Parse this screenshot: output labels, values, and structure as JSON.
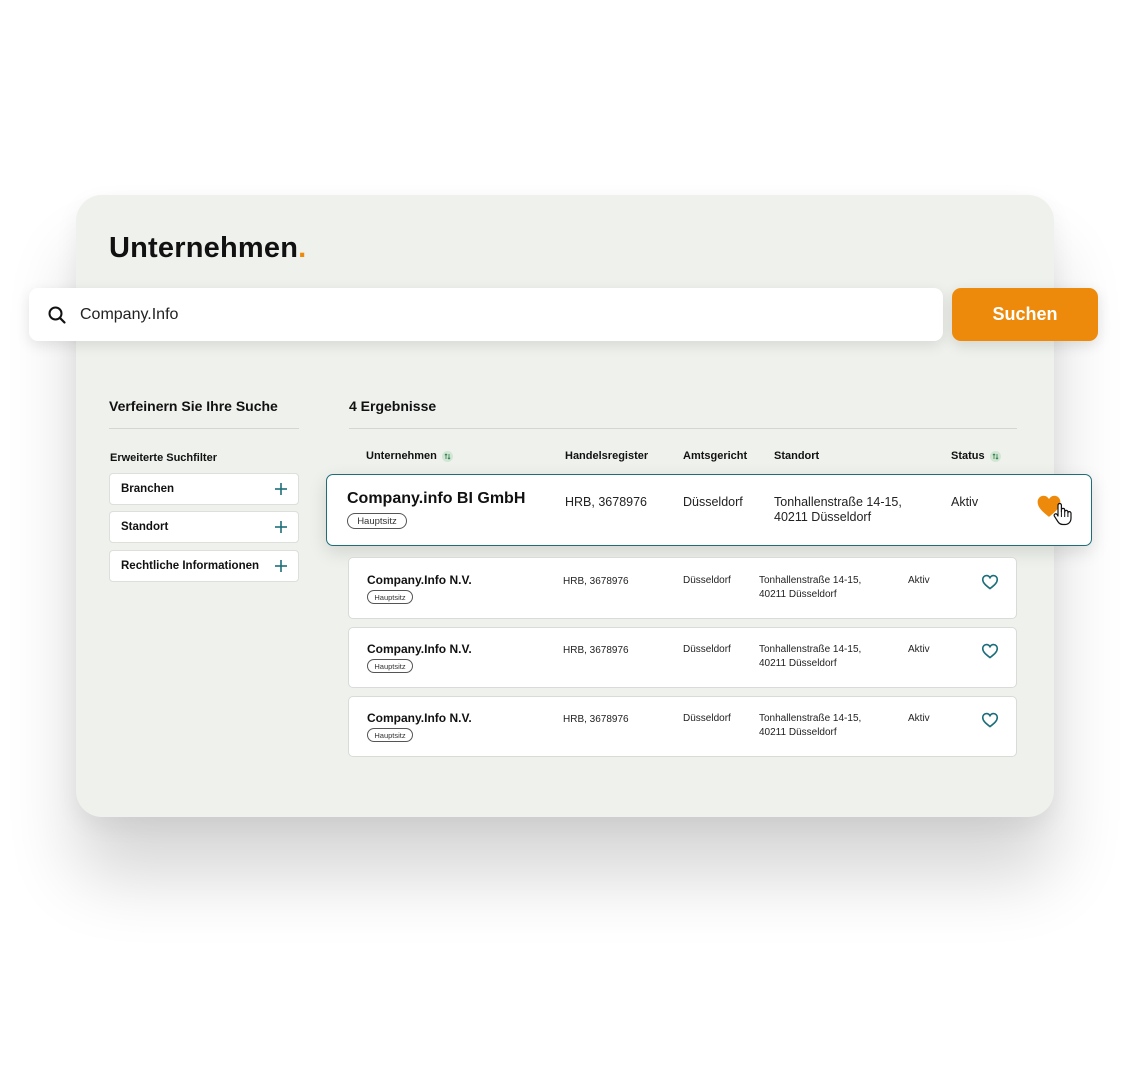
{
  "header": {
    "title": "Unternehmen",
    "title_dot": "."
  },
  "search": {
    "value": "Company.Info",
    "placeholder": "",
    "button_label": "Suchen"
  },
  "filters": {
    "heading": "Verfeinern Sie Ihre Suche",
    "subheading": "Erweiterte Suchfilter",
    "items": [
      {
        "label": "Branchen"
      },
      {
        "label": "Standort"
      },
      {
        "label": "Rechtliche Informationen"
      }
    ]
  },
  "results": {
    "count_label": "4 Ergebnisse",
    "columns": {
      "company": "Unternehmen",
      "register": "Handelsregister",
      "court": "Amtsgericht",
      "location": "Standort",
      "status": "Status"
    },
    "rows": [
      {
        "name": "Company.info BI GmbH",
        "tag": "Hauptsitz",
        "register": "HRB, 3678976",
        "court": "Düsseldorf",
        "address_line1": "Tonhallenstraße 14-15,",
        "address_line2": "40211 Düsseldorf",
        "status": "Aktiv",
        "favorite": true
      },
      {
        "name": "Company.Info  N.V.",
        "tag": "Hauptsitz",
        "register": "HRB, 3678976",
        "court": "Düsseldorf",
        "address_line1": "Tonhallenstraße 14-15,",
        "address_line2": "40211 Düsseldorf",
        "status": "Aktiv",
        "favorite": false
      },
      {
        "name": "Company.Info  N.V.",
        "tag": "Hauptsitz",
        "register": "HRB, 3678976",
        "court": "Düsseldorf",
        "address_line1": "Tonhallenstraße 14-15,",
        "address_line2": "40211 Düsseldorf",
        "status": "Aktiv",
        "favorite": false
      },
      {
        "name": "Company.Info  N.V.",
        "tag": "Hauptsitz",
        "register": "HRB, 3678976",
        "court": "Düsseldorf",
        "address_line1": "Tonhallenstraße 14-15,",
        "address_line2": "40211 Düsseldorf",
        "status": "Aktiv",
        "favorite": false
      }
    ]
  },
  "icons": {
    "search": "search-icon",
    "filter_add": "plus-icon",
    "sort": "sort-icon",
    "favorite": "heart-icon",
    "cursor": "hand-cursor-icon"
  },
  "colors": {
    "accent": "#ee8a0b",
    "teal": "#1d6e7a",
    "background": "#eef1ec"
  }
}
